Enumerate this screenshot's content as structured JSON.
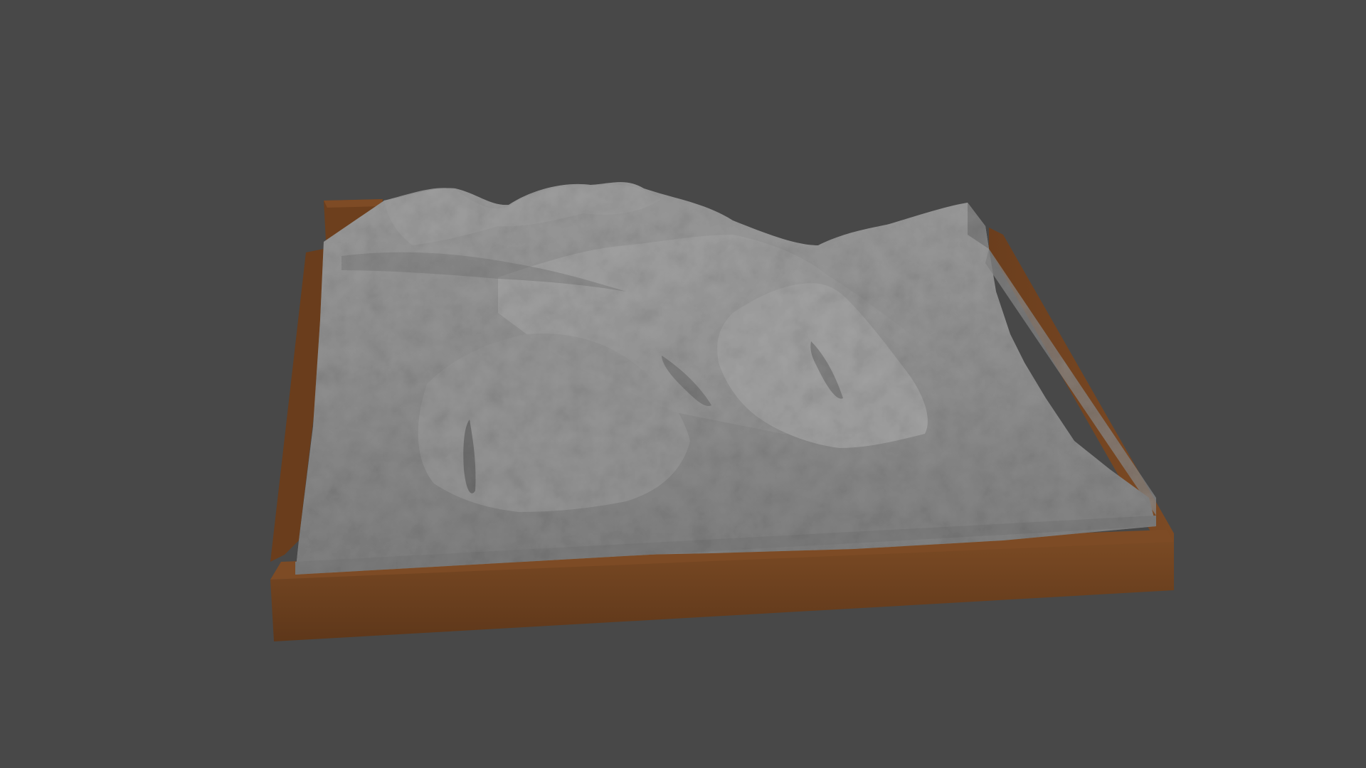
{
  "scene": {
    "background_color": "#484848",
    "terrain_color": "#8e8e8e",
    "base_color": "#6e4120",
    "label_glyphs": "",
    "objects": [
      "terrain-mesh",
      "model-base",
      "corner-label-block"
    ]
  }
}
